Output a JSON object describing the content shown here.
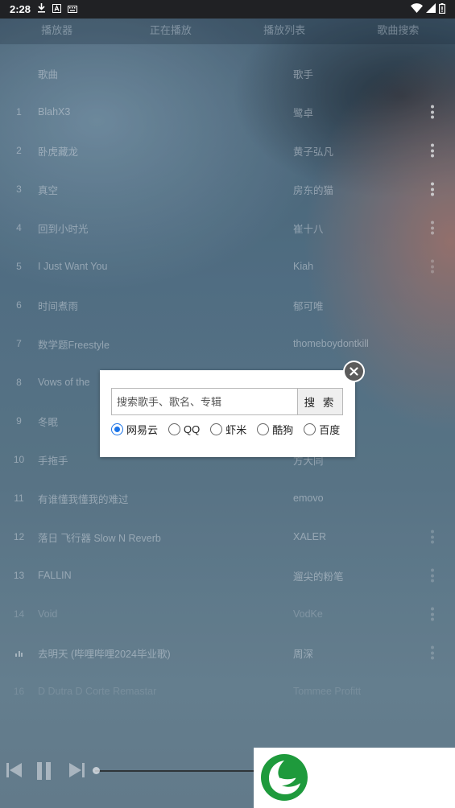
{
  "status_bar": {
    "time": "2:28"
  },
  "tabs": [
    {
      "label": "播放器"
    },
    {
      "label": "正在播放"
    },
    {
      "label": "播放列表"
    },
    {
      "label": "歌曲搜索"
    }
  ],
  "list": {
    "header": {
      "song": "歌曲",
      "artist": "歌手"
    },
    "rows": [
      {
        "index": "1",
        "song": "BlahX3",
        "artist": "鹭卓"
      },
      {
        "index": "2",
        "song": "卧虎藏龙",
        "artist": "黄子弘凡"
      },
      {
        "index": "3",
        "song": "真空",
        "artist": "房东的猫"
      },
      {
        "index": "4",
        "song": "回到小时光",
        "artist": "崔十八"
      },
      {
        "index": "5",
        "song": "I Just Want You",
        "artist": "Kiah"
      },
      {
        "index": "6",
        "song": "时间煮雨",
        "artist": "郁可唯"
      },
      {
        "index": "7",
        "song": "数学题Freestyle",
        "artist": "thomeboydontkill"
      },
      {
        "index": "8",
        "song": "Vows of the",
        "artist": ""
      },
      {
        "index": "9",
        "song": "冬眠",
        "artist": ""
      },
      {
        "index": "10",
        "song": "手拖手",
        "artist": "方大同"
      },
      {
        "index": "11",
        "song": "有谁懂我懂我的难过",
        "artist": "emovo"
      },
      {
        "index": "12",
        "song": "落日 飞行器 Slow N Reverb",
        "artist": "XALER"
      },
      {
        "index": "13",
        "song": "FALLIN",
        "artist": "遛尖的粉笔"
      },
      {
        "index": "14",
        "song": "Void",
        "artist": "VodKe"
      },
      {
        "index": "",
        "song": "去明天 (哔哩哔哩2024毕业歌)",
        "artist": "周深"
      },
      {
        "index": "16",
        "song": "D Dutra D Corte Remastar",
        "artist": "Tommee Profitt"
      }
    ]
  },
  "search_dialog": {
    "placeholder": "搜索歌手、歌名、专辑",
    "search_button": "搜 索",
    "sources": [
      {
        "label": "网易云",
        "checked": true
      },
      {
        "label": "QQ",
        "checked": false
      },
      {
        "label": "虾米",
        "checked": false
      },
      {
        "label": "酷狗",
        "checked": false
      },
      {
        "label": "百度",
        "checked": false
      }
    ]
  },
  "colors": {
    "accent": "#1a73e8",
    "logo_green": "#1e9a3c"
  }
}
